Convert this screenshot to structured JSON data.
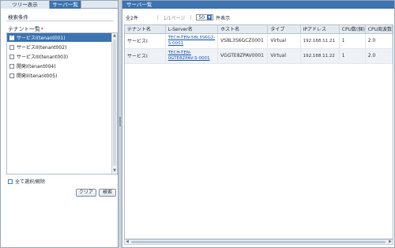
{
  "tabs": [
    {
      "label": "ツリー表示"
    },
    {
      "label": "サーバ一覧"
    }
  ],
  "left": {
    "section_title": "検索条件",
    "tenant_header": "テナント一覧",
    "required_mark": "*",
    "items": [
      {
        "label": "サービスI(tenant001)",
        "checked": true,
        "selected": true
      },
      {
        "label": "サービスII(tenant002)",
        "checked": false,
        "selected": false
      },
      {
        "label": "サービスIII(tenant003)",
        "checked": false,
        "selected": false
      },
      {
        "label": "開発I(tenant004)",
        "checked": false,
        "selected": false
      },
      {
        "label": "開発II(tenant005)",
        "checked": false,
        "selected": false
      }
    ],
    "select_all_label": "全て選択/解除",
    "clear_button": "クリア",
    "search_button": "検索"
  },
  "right": {
    "title": "サーバ一覧",
    "pager": {
      "total": "全2件",
      "page_info": "1/1ページ",
      "per_page": "50",
      "per_page_suffix": "件表示"
    },
    "columns": [
      "テナント名",
      "L-Server名",
      "ホスト名",
      "タイプ",
      "IPアドレス",
      "CPU数(個)",
      "CPU周波数"
    ],
    "rows": [
      {
        "tenant": "サービスI",
        "lserver": "TECH-TEN-58L3S6G2-S-0001",
        "host": "VS8L3S6GCZ0001",
        "type": "Virtual",
        "ip": "192.168.11.21",
        "cpu": "1",
        "freq": "2.0"
      },
      {
        "tenant": "サービスI",
        "lserver": "TECH-TEN-0GTE8ZPAV-S-0001",
        "host": "VGGTE8ZPAV0001",
        "type": "Virtual",
        "ip": "192.168.11.22",
        "cpu": "1",
        "freq": "2.0"
      }
    ]
  },
  "colors": {
    "accent": "#3d73b1",
    "panel_border": "#9aa6b4",
    "header_bg": "#e4eaf1",
    "link": "#1a56b4",
    "required": "#d01010"
  },
  "icons": {
    "dropdown": "chevron-down-icon",
    "checkbox": "checkbox-icon"
  }
}
